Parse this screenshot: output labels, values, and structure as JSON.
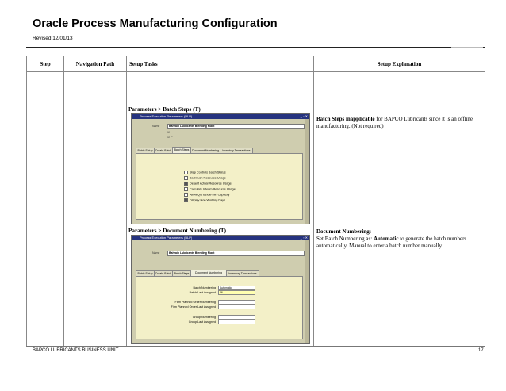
{
  "header": {
    "title": "Oracle Process Manufacturing Configuration",
    "revised": "Revised 12/01/13"
  },
  "table": {
    "columns": [
      "Step",
      "Navigation Path",
      "Setup Tasks",
      "Setup Explanation"
    ]
  },
  "sections": [
    {
      "task_label": "Parameters > Batch Steps (T)",
      "explanation_bold": "Batch Steps inapplicable",
      "explanation_rest": " for BAPCO Lubricants since it is an offline manufacturing. (Not required)",
      "form": {
        "window_title": "Process Execution Parameters (BLP)",
        "org_label": "Name",
        "org_value": "Bahrain Lubricants Blending Plant",
        "tabs": [
          "Batch Setup",
          "Create Batch",
          "Batch Steps",
          "Document Numbering",
          "Inventory Transactions"
        ],
        "active_tab": "Batch Steps",
        "checkboxes": [
          {
            "label": "Step Controls Batch Status",
            "checked": false
          },
          {
            "label": "Backflush Resource Usage",
            "checked": false
          },
          {
            "label": "Default Actual Resource Usage",
            "checked": true
          },
          {
            "label": "Calculate Interim Resource Usage",
            "checked": false
          },
          {
            "label": "Allow Qty Below Min Capacity",
            "checked": false
          },
          {
            "label": "Display Non Working Days",
            "checked": true
          }
        ]
      }
    },
    {
      "task_label": "Parameters > Document Numbering (T)",
      "explanation_bold": "Document Numbering:",
      "explanation_lines": [
        "Set Batch Numbering as:",
        "Automatic",
        "to generate the batch numbers automatically. Manual to enter a batch number manually."
      ],
      "form": {
        "window_title": "Process Execution Parameters (BLP)",
        "org_label": "Name",
        "org_value": "Bahrain Lubricants Blending Plant",
        "tabs": [
          "Batch Setup",
          "Create Batch",
          "Batch Steps",
          "Document Numbering",
          "Inventory Transactions"
        ],
        "active_tab": "Document Numbering",
        "fields": [
          {
            "label": "Batch Numbering",
            "value": "Automatic",
            "style": "select"
          },
          {
            "label": "Batch Last Assigned",
            "value": "26",
            "style": "yellow"
          },
          {
            "label": "Firm Planned Order Numbering",
            "value": "",
            "style": "select"
          },
          {
            "label": "Firm Planned Order Last Assigned",
            "value": "",
            "style": "plain"
          },
          {
            "label": "Group Numbering",
            "value": "",
            "style": "select"
          },
          {
            "label": "Group Last Assigned",
            "value": "",
            "style": "plain"
          }
        ]
      }
    }
  ],
  "footer": {
    "left": "BAPCO LUBRICANTS BUSINESS UNIT",
    "page": "17"
  }
}
